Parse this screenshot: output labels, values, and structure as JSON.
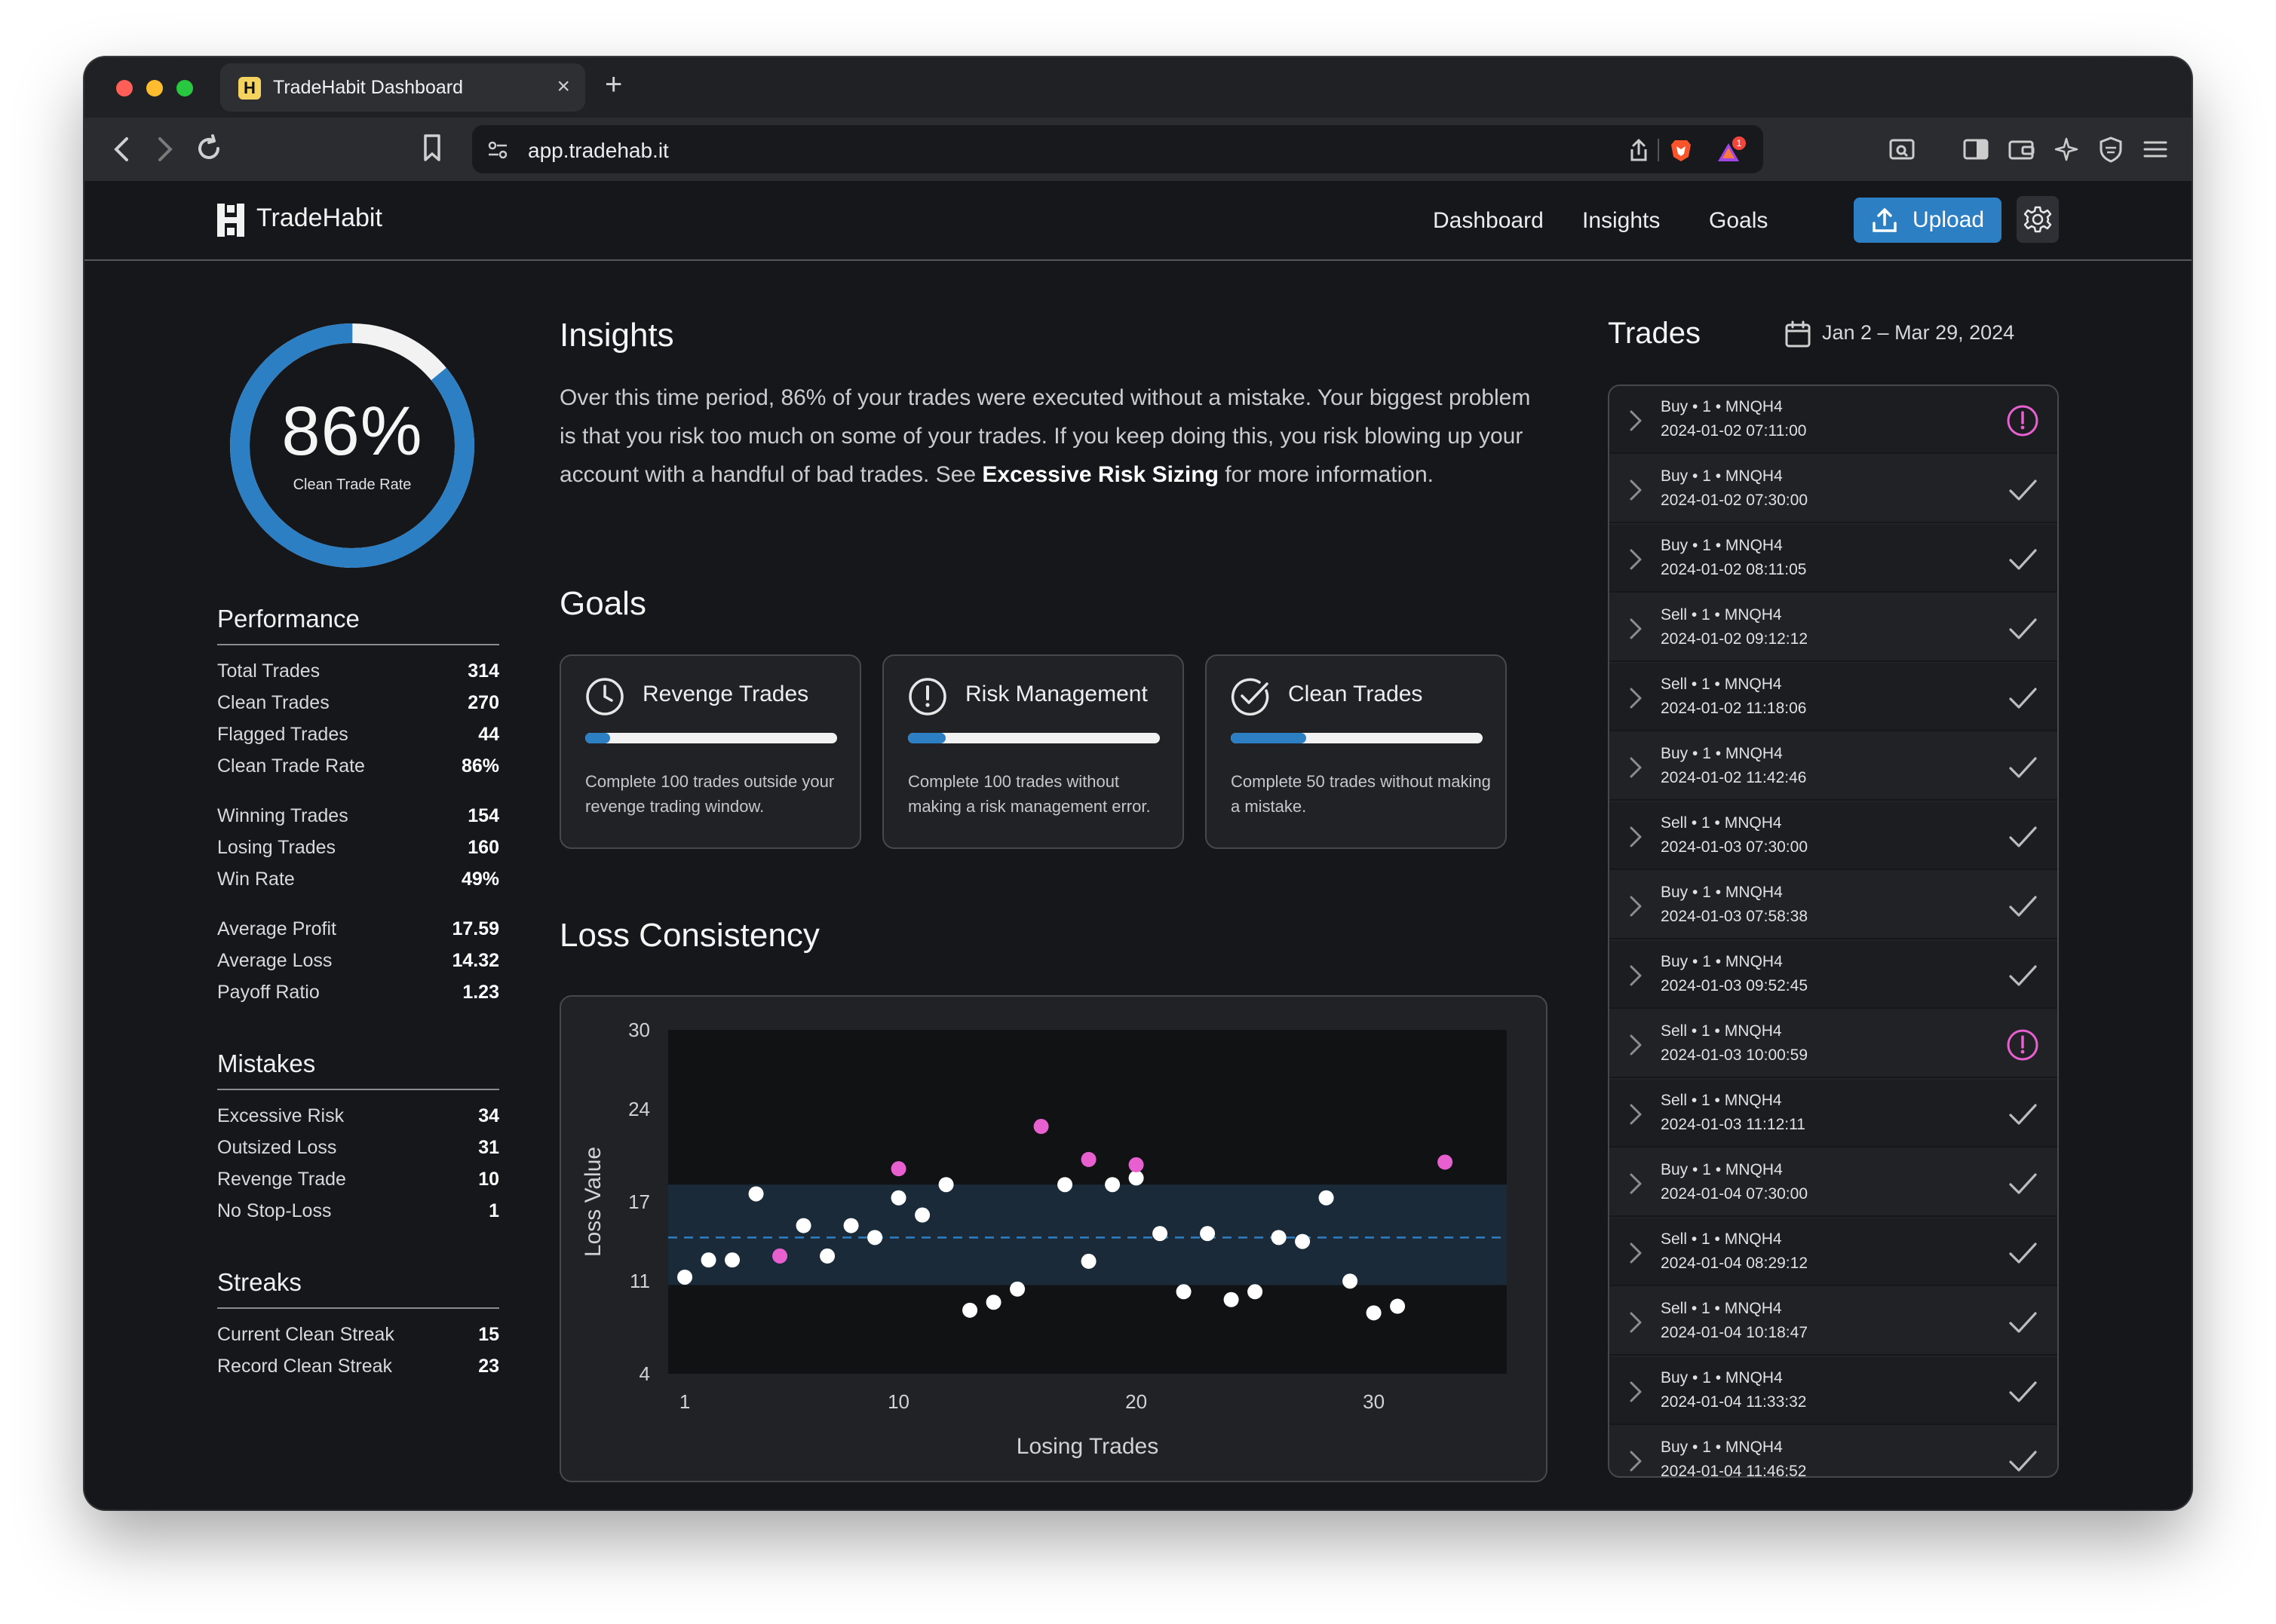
{
  "browser": {
    "tab_title": "TradeHabit Dashboard",
    "url": "app.tradehab.it",
    "rewards_badge": "1"
  },
  "header": {
    "brand": "TradeHabit",
    "nav": [
      "Dashboard",
      "Insights",
      "Goals"
    ],
    "upload_label": "Upload"
  },
  "summary": {
    "clean_rate": "86%",
    "clean_rate_value": 0.86,
    "clean_rate_label": "Clean Trade Rate"
  },
  "performance": {
    "title": "Performance",
    "rows": [
      {
        "label": "Total Trades",
        "value": "314"
      },
      {
        "label": "Clean Trades",
        "value": "270"
      },
      {
        "label": "Flagged Trades",
        "value": "44"
      },
      {
        "label": "Clean Trade Rate",
        "value": "86%"
      },
      {
        "label": "Winning Trades",
        "value": "154"
      },
      {
        "label": "Losing Trades",
        "value": "160"
      },
      {
        "label": "Win Rate",
        "value": "49%"
      },
      {
        "label": "Average Profit",
        "value": "17.59"
      },
      {
        "label": "Average Loss",
        "value": "14.32"
      },
      {
        "label": "Payoff Ratio",
        "value": "1.23"
      }
    ]
  },
  "mistakes": {
    "title": "Mistakes",
    "rows": [
      {
        "label": "Excessive Risk",
        "value": "34"
      },
      {
        "label": "Outsized Loss",
        "value": "31"
      },
      {
        "label": "Revenge Trade",
        "value": "10"
      },
      {
        "label": "No Stop-Loss",
        "value": "1"
      }
    ]
  },
  "streaks": {
    "title": "Streaks",
    "rows": [
      {
        "label": "Current Clean Streak",
        "value": "15"
      },
      {
        "label": "Record Clean Streak",
        "value": "23"
      }
    ]
  },
  "insights": {
    "title": "Insights",
    "text_before": "Over this time period, 86% of your trades were executed without a mistake. Your biggest problem is that you risk too much on some of your trades. If you keep doing this, you risk blowing up your account with a handful of bad trades. See ",
    "link": "Excessive Risk Sizing",
    "text_after": " for more information."
  },
  "goals": {
    "title": "Goals",
    "items": [
      {
        "title": "Revenge Trades",
        "description": "Complete 100 trades outside your revenge trading window.",
        "progress": 0.1,
        "icon": "clock-icon"
      },
      {
        "title": "Risk Management",
        "description": "Complete 100 trades without making a risk management error.",
        "progress": 0.15,
        "icon": "alert-icon"
      },
      {
        "title": "Clean Trades",
        "description": "Complete 50 trades without making a mistake.",
        "progress": 0.3,
        "icon": "check-circle-icon"
      }
    ]
  },
  "loss_consistency": {
    "title": "Loss Consistency"
  },
  "chart_data": {
    "type": "scatter",
    "title": "Loss Consistency",
    "xlabel": "Losing Trades",
    "ylabel": "Loss Value",
    "xlim": [
      0.3,
      35.6
    ],
    "ylim": [
      4,
      30
    ],
    "xticks": [
      1,
      10,
      20,
      30
    ],
    "yticks": [
      4,
      11,
      17,
      24,
      30
    ],
    "mean_line": 14.3,
    "band": [
      10.7,
      18.3
    ],
    "grid": false,
    "legend": "none",
    "colors": {
      "normal": "#ffffff",
      "flagged": "#e860d0",
      "band": "#1a2a38",
      "mean": "#2d7fc4"
    },
    "series": [
      {
        "points": [
          {
            "x": 1,
            "y": 11.3
          },
          {
            "x": 2,
            "y": 12.6
          },
          {
            "x": 3,
            "y": 12.6
          },
          {
            "x": 4,
            "y": 17.6
          },
          {
            "x": 6,
            "y": 15.2
          },
          {
            "x": 7,
            "y": 12.9
          },
          {
            "x": 8,
            "y": 15.2
          },
          {
            "x": 9,
            "y": 14.3
          },
          {
            "x": 10,
            "y": 17.3
          },
          {
            "x": 11,
            "y": 16.0
          },
          {
            "x": 12,
            "y": 18.3
          },
          {
            "x": 13,
            "y": 8.8
          },
          {
            "x": 14,
            "y": 9.4
          },
          {
            "x": 15,
            "y": 10.4
          },
          {
            "x": 17,
            "y": 18.3
          },
          {
            "x": 18,
            "y": 12.5
          },
          {
            "x": 19,
            "y": 18.3
          },
          {
            "x": 20,
            "y": 18.8
          },
          {
            "x": 21,
            "y": 14.6
          },
          {
            "x": 22,
            "y": 10.2
          },
          {
            "x": 23,
            "y": 14.6
          },
          {
            "x": 24,
            "y": 9.6
          },
          {
            "x": 25,
            "y": 10.2
          },
          {
            "x": 26,
            "y": 14.3
          },
          {
            "x": 27,
            "y": 14.0
          },
          {
            "x": 28,
            "y": 17.3
          },
          {
            "x": 29,
            "y": 11.0
          },
          {
            "x": 30,
            "y": 8.6
          },
          {
            "x": 31,
            "y": 9.1
          }
        ]
      },
      {
        "flagged": true,
        "points": [
          {
            "x": 5,
            "y": 12.9
          },
          {
            "x": 10,
            "y": 19.5
          },
          {
            "x": 16,
            "y": 22.7
          },
          {
            "x": 18,
            "y": 20.2
          },
          {
            "x": 20,
            "y": 19.8
          },
          {
            "x": 33,
            "y": 20.0
          }
        ]
      }
    ]
  },
  "trades": {
    "title": "Trades",
    "date_range": "Jan 2 – Mar 29, 2024",
    "rows": [
      {
        "summary": "Buy • 1 • MNQH4",
        "time": "2024-01-02 07:11:00",
        "status": "flagged"
      },
      {
        "summary": "Buy • 1 • MNQH4",
        "time": "2024-01-02 07:30:00",
        "status": "clean"
      },
      {
        "summary": "Buy • 1 • MNQH4",
        "time": "2024-01-02 08:11:05",
        "status": "clean"
      },
      {
        "summary": "Sell • 1 • MNQH4",
        "time": "2024-01-02 09:12:12",
        "status": "clean"
      },
      {
        "summary": "Sell • 1 • MNQH4",
        "time": "2024-01-02 11:18:06",
        "status": "clean"
      },
      {
        "summary": "Buy • 1 • MNQH4",
        "time": "2024-01-02 11:42:46",
        "status": "clean"
      },
      {
        "summary": "Sell • 1 • MNQH4",
        "time": "2024-01-03 07:30:00",
        "status": "clean"
      },
      {
        "summary": "Buy • 1 • MNQH4",
        "time": "2024-01-03 07:58:38",
        "status": "clean"
      },
      {
        "summary": "Buy • 1 • MNQH4",
        "time": "2024-01-03 09:52:45",
        "status": "clean"
      },
      {
        "summary": "Sell • 1 • MNQH4",
        "time": "2024-01-03 10:00:59",
        "status": "flagged"
      },
      {
        "summary": "Sell • 1 • MNQH4",
        "time": "2024-01-03 11:12:11",
        "status": "clean"
      },
      {
        "summary": "Buy • 1 • MNQH4",
        "time": "2024-01-04 07:30:00",
        "status": "clean"
      },
      {
        "summary": "Sell • 1 • MNQH4",
        "time": "2024-01-04 08:29:12",
        "status": "clean"
      },
      {
        "summary": "Sell • 1 • MNQH4",
        "time": "2024-01-04 10:18:47",
        "status": "clean"
      },
      {
        "summary": "Buy • 1 • MNQH4",
        "time": "2024-01-04 11:33:32",
        "status": "clean"
      },
      {
        "summary": "Buy • 1 • MNQH4",
        "time": "2024-01-04 11:46:52",
        "status": "clean"
      }
    ]
  }
}
